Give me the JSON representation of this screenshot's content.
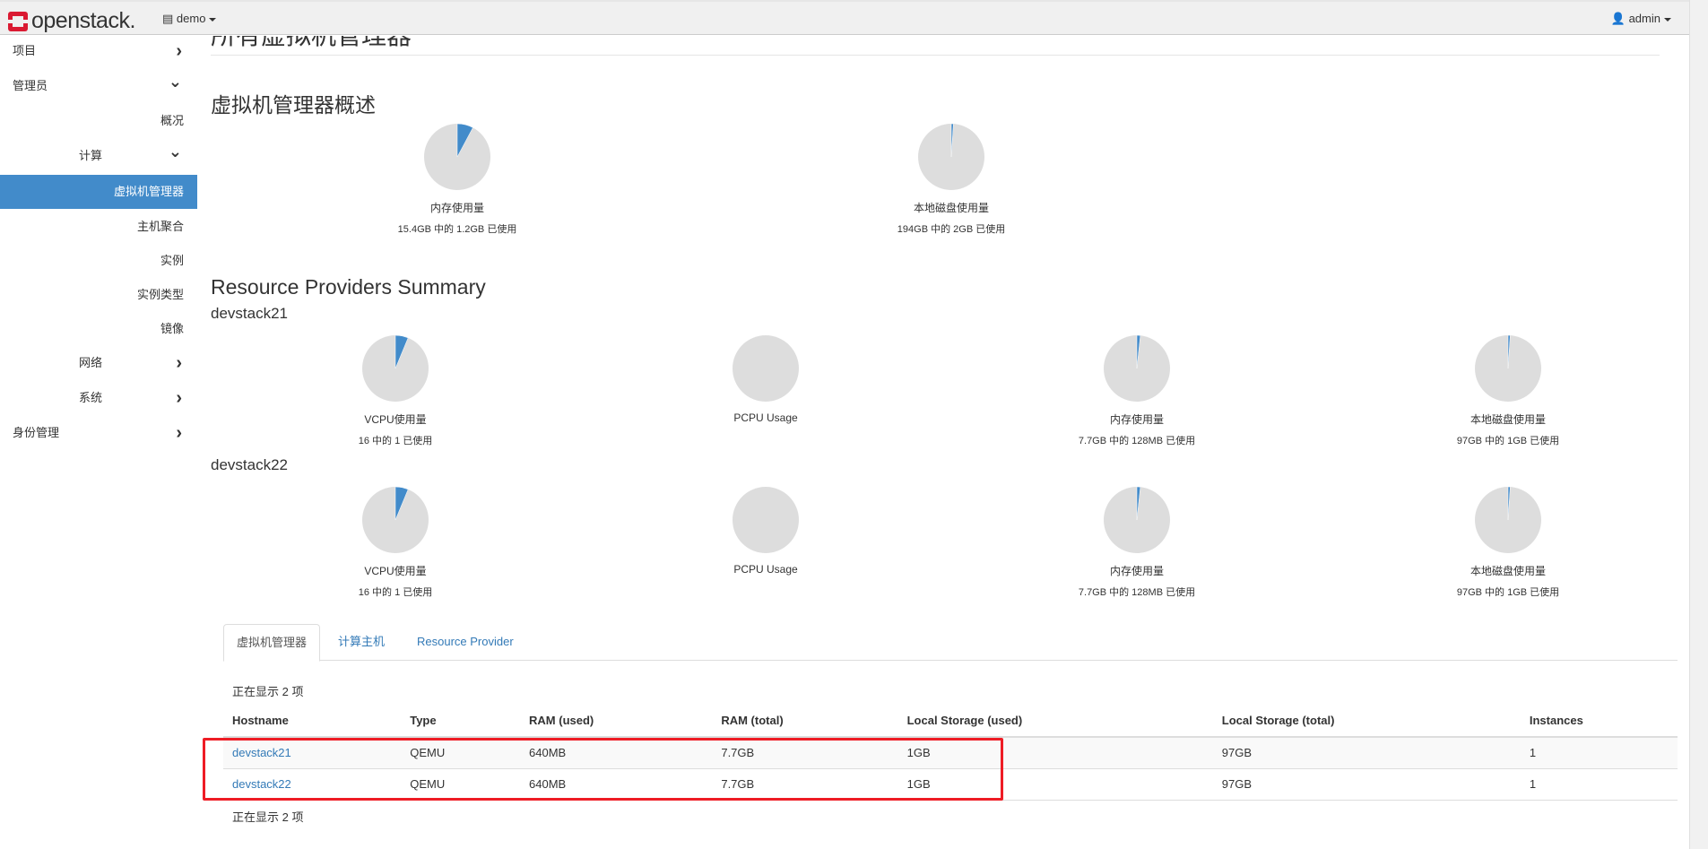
{
  "header": {
    "brand": "openstack.",
    "project": "demo",
    "user": "admin"
  },
  "sidebar": {
    "items": [
      {
        "label": "项目",
        "chevron": "right"
      },
      {
        "label": "管理员",
        "chevron": "down"
      },
      {
        "label": "概况"
      },
      {
        "label": "计算",
        "chevron": "down"
      },
      {
        "label": "虚拟机管理器",
        "active": true
      },
      {
        "label": "主机聚合"
      },
      {
        "label": "实例"
      },
      {
        "label": "实例类型"
      },
      {
        "label": "镜像"
      },
      {
        "label": "网络",
        "chevron": "right"
      },
      {
        "label": "系统",
        "chevron": "right"
      },
      {
        "label": "身份管理",
        "chevron": "right"
      }
    ]
  },
  "page": {
    "title": "所有虚拟机管理器",
    "overview_title": "虚拟机管理器概述",
    "rp_title": "Resource Providers Summary"
  },
  "colors": {
    "used": "#428bca",
    "free": "#dddddd",
    "accent": "#428bca",
    "highlight": "#ee1c25"
  },
  "overview": [
    {
      "title": "内存使用量",
      "subtitle": "15.4GB 中的 1.2GB 已使用",
      "used": 1.2,
      "total": 15.4
    },
    {
      "title": "本地磁盘使用量",
      "subtitle": "194GB 中的 2GB 已使用",
      "used": 2,
      "total": 194
    }
  ],
  "providers": [
    {
      "name": "devstack21",
      "charts": [
        {
          "title": "VCPU使用量",
          "subtitle": "16 中的 1 已使用",
          "used": 1,
          "total": 16
        },
        {
          "title": "PCPU Usage",
          "subtitle": "",
          "used": 0,
          "total": 1
        },
        {
          "title": "内存使用量",
          "subtitle": "7.7GB 中的 128MB 已使用",
          "used": 0.128,
          "total": 7.7
        },
        {
          "title": "本地磁盘使用量",
          "subtitle": "97GB 中的 1GB 已使用",
          "used": 1,
          "total": 97
        }
      ]
    },
    {
      "name": "devstack22",
      "charts": [
        {
          "title": "VCPU使用量",
          "subtitle": "16 中的 1 已使用",
          "used": 1,
          "total": 16
        },
        {
          "title": "PCPU Usage",
          "subtitle": "",
          "used": 0,
          "total": 1
        },
        {
          "title": "内存使用量",
          "subtitle": "7.7GB 中的 128MB 已使用",
          "used": 0.128,
          "total": 7.7
        },
        {
          "title": "本地磁盘使用量",
          "subtitle": "97GB 中的 1GB 已使用",
          "used": 1,
          "total": 97
        }
      ]
    }
  ],
  "tabs": [
    {
      "label": "虚拟机管理器"
    },
    {
      "label": "计算主机"
    },
    {
      "label": "Resource Provider"
    }
  ],
  "table": {
    "count_text": "正在显示 2 项",
    "columns": [
      "Hostname",
      "Type",
      "RAM (used)",
      "RAM (total)",
      "Local Storage (used)",
      "Local Storage (total)",
      "Instances"
    ],
    "rows": [
      [
        "devstack21",
        "QEMU",
        "640MB",
        "7.7GB",
        "1GB",
        "97GB",
        "1"
      ],
      [
        "devstack22",
        "QEMU",
        "640MB",
        "7.7GB",
        "1GB",
        "97GB",
        "1"
      ]
    ]
  }
}
